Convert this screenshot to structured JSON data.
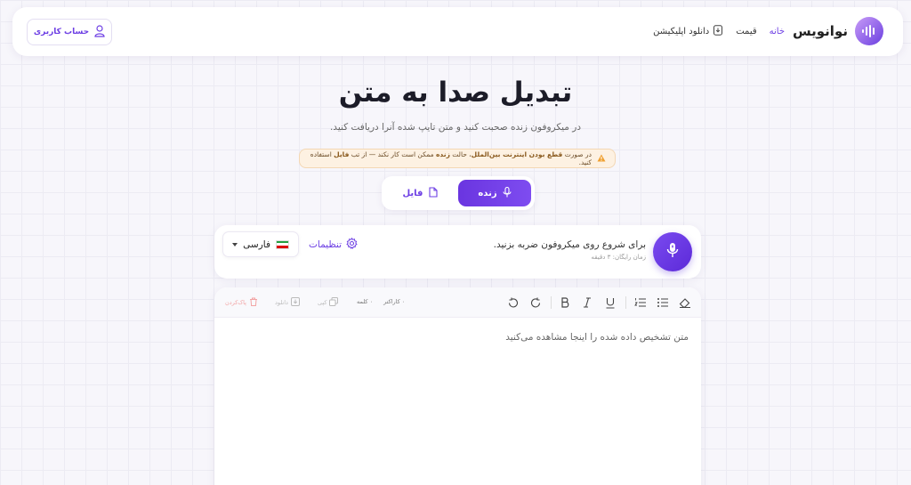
{
  "brand": {
    "name": "نوانویس",
    "icon": "sound-wave-icon"
  },
  "nav": {
    "home": "خانه",
    "price": "قیمت",
    "download_app": "دانلود اپلیکیشن"
  },
  "account": {
    "label": "حساب کاربری"
  },
  "hero": {
    "title": "تبدیل صدا به متن",
    "subtitle": "در میکروفون زنده صحبت کنید و متن تایپ شده آنرا دریافت کنید."
  },
  "warning": {
    "part1": "در صورت ",
    "bold1": "قطع بودن اینترنت بین‌الملل",
    "part2": "، حالت ",
    "bold2": "زنده",
    "part3": " ممکن است کار نکند — از تب ",
    "bold3": "فایل",
    "part4": " استفاده کنید."
  },
  "modes": {
    "live": "زنده",
    "file": "فایل"
  },
  "recorder": {
    "prompt": "برای شروع روی میکروفون ضربه بزنید.",
    "free_time": "زمان رایگان: ۳ دقیقه",
    "settings": "تنظیمات",
    "language": "فارسی"
  },
  "editor": {
    "chars": "۰ کاراکتر",
    "words": "۰ کلمه",
    "copy": "کپی",
    "download": "دانلود",
    "clear": "پاک‌کردن",
    "placeholder": "متن تشخیص داده شده را اینجا مشاهده می‌کنید"
  },
  "colors": {
    "accent": "#6d3fe4",
    "warning_bg": "#fdf1e2"
  }
}
